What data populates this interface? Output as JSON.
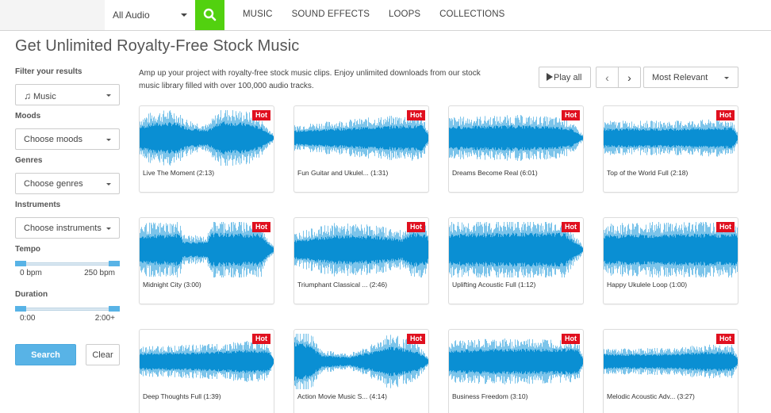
{
  "topbar": {
    "audio_select": "All Audio",
    "search_icon": "search-icon",
    "nav": [
      "MUSIC",
      "SOUND EFFECTS",
      "LOOPS",
      "COLLECTIONS"
    ],
    "accent_color": "#52d10f"
  },
  "page_title": "Get Unlimited Royalty-Free Stock Music",
  "sidebar": {
    "filter_label": "Filter your results",
    "filter_value": "Music",
    "filter_icon": "music-note-icon",
    "moods_label": "Moods",
    "moods_value": "Choose moods",
    "genres_label": "Genres",
    "genres_value": "Choose genres",
    "instruments_label": "Instruments",
    "instruments_value": "Choose instruments",
    "tempo": {
      "label": "Tempo",
      "min_label": "0 bpm",
      "max_label": "250 bpm",
      "range": [
        0,
        1
      ]
    },
    "duration": {
      "label": "Duration",
      "min_label": "0:00",
      "max_label": "2:00+",
      "range": [
        0,
        1
      ]
    },
    "search_label": "Search",
    "clear_label": "Clear"
  },
  "intro": "Amp up your project with royalty-free stock music clips. Enjoy unlimited downloads from our stock music library filled with over 100,000 audio tracks.",
  "controls": {
    "play_all": "Play all",
    "prev": "‹",
    "next": "›",
    "sort": "Most Relevant"
  },
  "badge_label": "Hot",
  "wave_color": "#0a8fd3",
  "tracks": [
    {
      "title": "Live The Moment (2:13)",
      "hot": true
    },
    {
      "title": "Fun Guitar and Ukulel... (1:31)",
      "hot": true
    },
    {
      "title": "Dreams Become Real (6:01)",
      "hot": true
    },
    {
      "title": "Top of the World Full (2:18)",
      "hot": true
    },
    {
      "title": "Midnight City (3:00)",
      "hot": true
    },
    {
      "title": "Triumphant Classical ...  (2:46)",
      "hot": true
    },
    {
      "title": "Uplifting Acoustic Full (1:12)",
      "hot": true
    },
    {
      "title": "Happy Ukulele Loop (1:00)",
      "hot": true
    },
    {
      "title": "Deep Thoughts Full (1:39)",
      "hot": true
    },
    {
      "title": "Action Movie Music S... (4:14)",
      "hot": true
    },
    {
      "title": "Business Freedom (3:10)",
      "hot": true
    },
    {
      "title": "Melodic Acoustic Adv... (3:27)",
      "hot": true
    }
  ]
}
